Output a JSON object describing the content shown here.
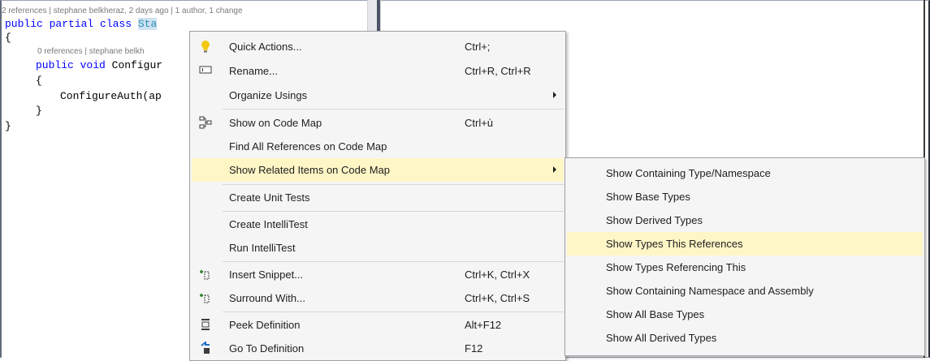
{
  "editor": {
    "codelens_class": "2 references | stephane belkheraz, 2 days ago | 1 author, 1 change",
    "codelens_method": "0 references | stephane belkh",
    "lines": {
      "class_kw1": "public",
      "class_kw2": "partial",
      "class_kw3": "class",
      "class_name": "Sta",
      "brace_open": "{",
      "method_kw1": "public",
      "method_kw2": "void",
      "method_name": "Configur",
      "brace_open2": "{",
      "call": "ConfigureAuth(ap",
      "brace_close2": "}",
      "brace_close": "}"
    }
  },
  "context_menu": {
    "items": [
      {
        "icon": "lightbulb-icon",
        "label": "Quick Actions...",
        "shortcut": "Ctrl+;"
      },
      {
        "icon": "rename-icon",
        "label": "Rename...",
        "shortcut": "Ctrl+R, Ctrl+R"
      },
      {
        "icon": "",
        "label": "Organize Usings",
        "shortcut": ""
      },
      {
        "icon": "code-map-icon",
        "label": "Show on Code Map",
        "shortcut": "Ctrl+ù"
      },
      {
        "icon": "",
        "label": "Find All References on Code Map",
        "shortcut": ""
      },
      {
        "icon": "",
        "label": "Show Related Items on Code Map",
        "shortcut": ""
      },
      {
        "icon": "",
        "label": "Create Unit Tests",
        "shortcut": ""
      },
      {
        "icon": "",
        "label": "Create IntelliTest",
        "shortcut": ""
      },
      {
        "icon": "",
        "label": "Run IntelliTest",
        "shortcut": ""
      },
      {
        "icon": "insert-snippet-icon",
        "label": "Insert Snippet...",
        "shortcut": "Ctrl+K, Ctrl+X"
      },
      {
        "icon": "surround-with-icon",
        "label": "Surround With...",
        "shortcut": "Ctrl+K, Ctrl+S"
      },
      {
        "icon": "peek-definition-icon",
        "label": "Peek Definition",
        "shortcut": "Alt+F12"
      },
      {
        "icon": "go-to-definition-icon",
        "label": "Go To Definition",
        "shortcut": "F12"
      }
    ]
  },
  "submenu": {
    "items": [
      {
        "label": "Show Containing Type/Namespace"
      },
      {
        "label": "Show Base Types"
      },
      {
        "label": "Show Derived Types"
      },
      {
        "label": "Show Types This References"
      },
      {
        "label": "Show Types Referencing This"
      },
      {
        "label": "Show Containing Namespace and Assembly"
      },
      {
        "label": "Show All Base Types"
      },
      {
        "label": "Show All Derived Types"
      }
    ]
  },
  "colors": {
    "menu_background": "#f5f5f5",
    "highlight": "#fff6c6",
    "keyword": "#0000ff",
    "type_name": "#2b91af",
    "codelens": "#7a7a7a"
  }
}
